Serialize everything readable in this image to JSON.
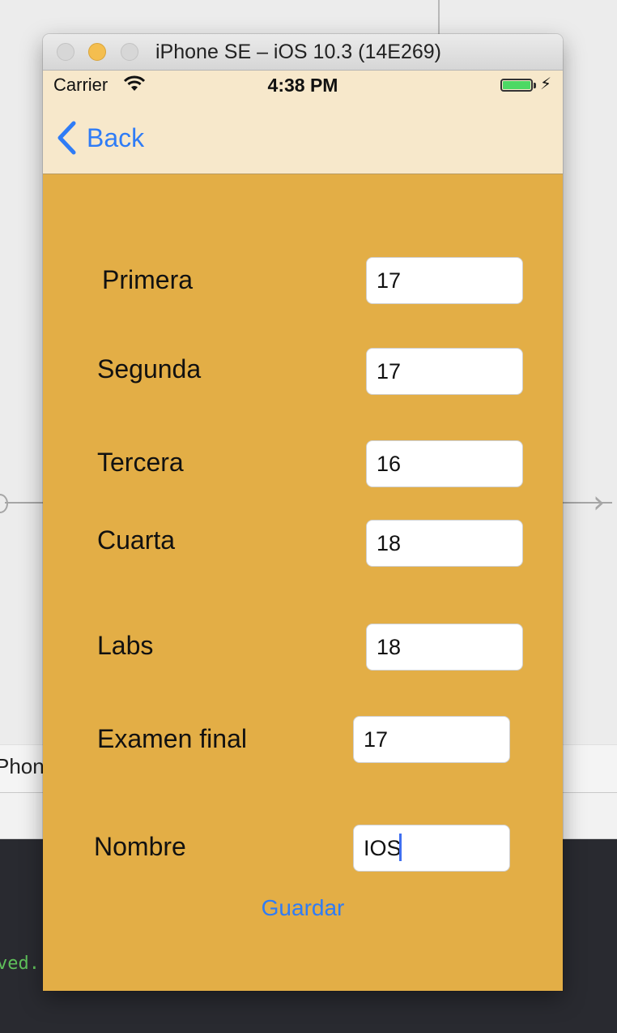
{
  "backdrop": {
    "device_bar_text": "Phone",
    "console_text": "ved."
  },
  "window": {
    "title": "iPhone SE – iOS 10.3 (14E269)",
    "traffic_lights": [
      "close",
      "minimize",
      "zoom"
    ]
  },
  "status_bar": {
    "carrier": "Carrier",
    "time": "4:38 PM",
    "battery_level": 1.0,
    "charging": true
  },
  "nav": {
    "back_label": "Back"
  },
  "form": {
    "rows": [
      {
        "label": "Primera",
        "value": "17"
      },
      {
        "label": "Segunda",
        "value": "17"
      },
      {
        "label": "Tercera",
        "value": "16"
      },
      {
        "label": "Cuarta",
        "value": "18"
      },
      {
        "label": "Labs",
        "value": "18"
      },
      {
        "label": "Examen final",
        "value": "17"
      },
      {
        "label": "Nombre",
        "value": "IOS"
      }
    ],
    "save_label": "Guardar"
  },
  "colors": {
    "screen_background": "#e3ae46",
    "nav_background": "#f7e8cb",
    "accent": "#2f7cf6"
  }
}
